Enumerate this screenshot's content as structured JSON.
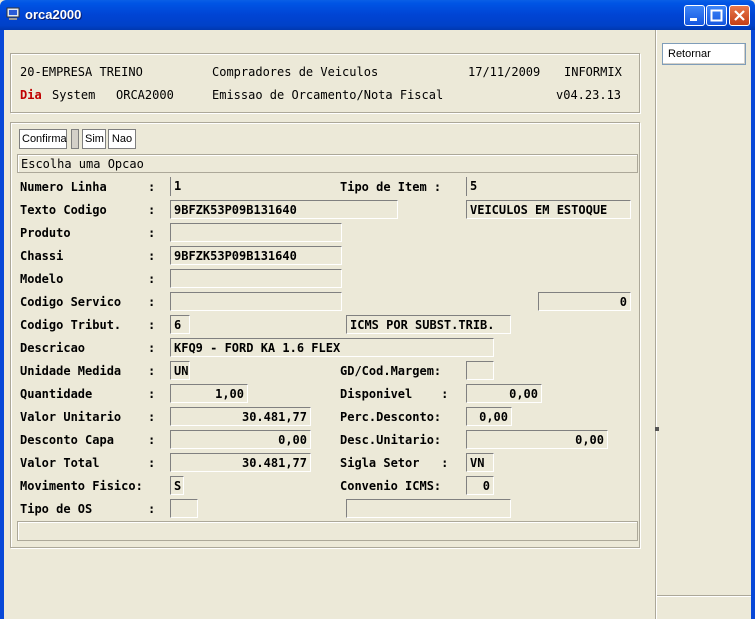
{
  "window": {
    "title": "orca2000"
  },
  "side": {
    "retornar": "Retornar"
  },
  "header": {
    "company": "20-EMPRESA TREINO",
    "screen_title": "Compradores de Veiculos",
    "date": "17/11/2009",
    "db": "INFORMIX",
    "day": "Dia",
    "system": "System",
    "module": "ORCA2000",
    "subtitle": "Emissao de Orcamento/Nota Fiscal",
    "version": "v04.23.13"
  },
  "toolbar": {
    "confirm": "Confirma",
    "yes": "Sim",
    "no": "Nao"
  },
  "prompt": "Escolha uma Opcao",
  "form": {
    "numero_linha": {
      "label": "Numero Linha",
      "value": "1"
    },
    "tipo_item": {
      "label": "Tipo de Item :",
      "value": "5"
    },
    "texto_codigo": {
      "label": "Texto Codigo",
      "value": "9BFZK53P09B131640",
      "extra": "VEICULOS EM ESTOQUE"
    },
    "produto": {
      "label": "Produto",
      "value": ""
    },
    "chassi": {
      "label": "Chassi",
      "value": "9BFZK53P09B131640"
    },
    "modelo": {
      "label": "Modelo",
      "value": ""
    },
    "codigo_servico": {
      "label": "Codigo Servico",
      "value": "",
      "extra": "0"
    },
    "codigo_tribut": {
      "label": "Codigo Tribut.",
      "value": "6",
      "extra": "ICMS POR SUBST.TRIB."
    },
    "descricao": {
      "label": "Descricao",
      "value": "KFQ9 - FORD KA 1.6 FLEX"
    },
    "unidade_medida": {
      "label": "Unidade Medida",
      "value": "UN"
    },
    "gd_cod_margem": {
      "label": "GD/Cod.Margem:",
      "value": ""
    },
    "quantidade": {
      "label": "Quantidade",
      "value": "1,00"
    },
    "disponivel": {
      "label": "Disponivel    :",
      "value": "0,00"
    },
    "valor_unitario": {
      "label": "Valor Unitario",
      "value": "30.481,77"
    },
    "perc_desconto": {
      "label": "Perc.Desconto:",
      "value": "0,00"
    },
    "desconto_capa": {
      "label": "Desconto Capa",
      "value": "0,00"
    },
    "desc_unitario": {
      "label": "Desc.Unitario:",
      "value": "0,00"
    },
    "valor_total": {
      "label": "Valor Total",
      "value": "30.481,77"
    },
    "sigla_setor": {
      "label": "Sigla Setor   :",
      "value": "VN"
    },
    "movimento_fisico": {
      "label": "Movimento Fisico:",
      "value": "S"
    },
    "convenio_icms": {
      "label": "Convenio ICMS:",
      "value": "0"
    },
    "tipo_os": {
      "label": "Tipo de OS",
      "value": "",
      "extra": ""
    }
  },
  "colon": ":"
}
